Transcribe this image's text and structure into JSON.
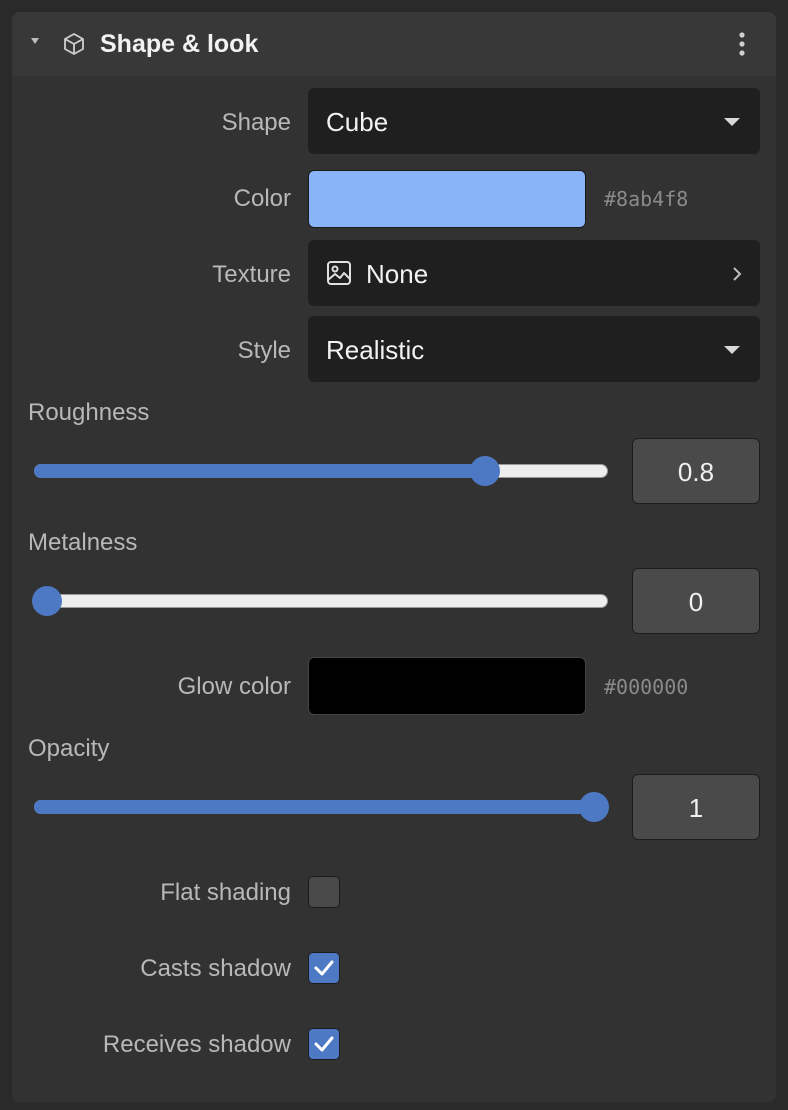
{
  "panel": {
    "title": "Shape & look",
    "icons": {
      "collapse": "triangle-down-icon",
      "section": "cube-icon",
      "menu": "more-vertical-icon"
    }
  },
  "shape": {
    "label": "Shape",
    "value": "Cube"
  },
  "color": {
    "label": "Color",
    "hex": "#8ab4f8"
  },
  "texture": {
    "label": "Texture",
    "value": "None",
    "icon": "image-icon"
  },
  "style": {
    "label": "Style",
    "value": "Realistic"
  },
  "roughness": {
    "label": "Roughness",
    "value": "0.8",
    "fraction": 0.8
  },
  "metalness": {
    "label": "Metalness",
    "value": "0",
    "fraction": 0
  },
  "glow": {
    "label": "Glow color",
    "hex": "#000000"
  },
  "opacity": {
    "label": "Opacity",
    "value": "1",
    "fraction": 1
  },
  "flat_shading": {
    "label": "Flat shading",
    "checked": false
  },
  "casts_shadow": {
    "label": "Casts shadow",
    "checked": true
  },
  "receives_shadow": {
    "label": "Receives shadow",
    "checked": true
  },
  "colors": {
    "accent": "#4d79c4",
    "panel_bg": "#323232",
    "header_bg": "#383838"
  }
}
